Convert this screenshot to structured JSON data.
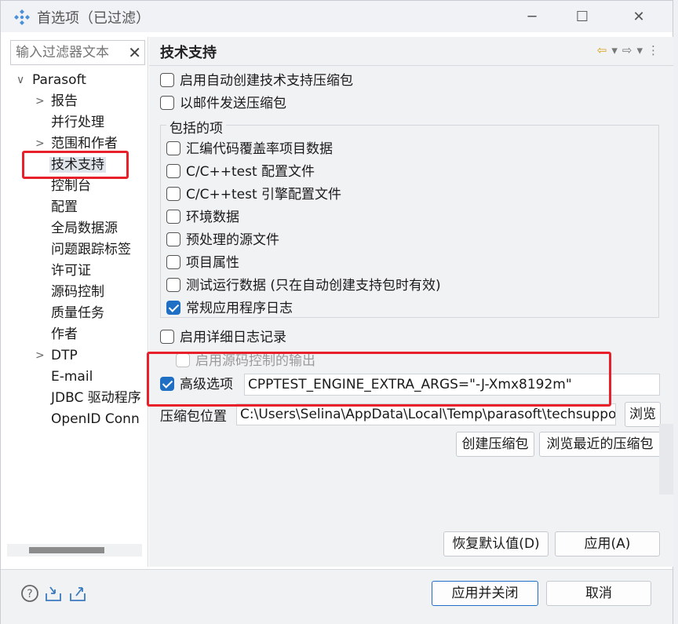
{
  "window": {
    "title": "首选项（已过滤）",
    "minimize": "─",
    "maximize": "☐",
    "close": "✕"
  },
  "filter": {
    "value": "输入过滤器文本",
    "clear": "✕"
  },
  "tree": [
    {
      "label": "Parasoft",
      "arrow": "∨"
    },
    {
      "label": "报告",
      "arrow": ">"
    },
    {
      "label": "并行处理",
      "arrow": ""
    },
    {
      "label": "范围和作者",
      "arrow": ">"
    },
    {
      "label": "技术支持",
      "arrow": "",
      "selected": true
    },
    {
      "label": "控制台",
      "arrow": ""
    },
    {
      "label": "配置",
      "arrow": ""
    },
    {
      "label": "全局数据源",
      "arrow": ""
    },
    {
      "label": "问题跟踪标签",
      "arrow": ""
    },
    {
      "label": "许可证",
      "arrow": ""
    },
    {
      "label": "源码控制",
      "arrow": ""
    },
    {
      "label": "质量任务",
      "arrow": ""
    },
    {
      "label": "作者",
      "arrow": ""
    },
    {
      "label": "DTP",
      "arrow": ">"
    },
    {
      "label": "E-mail",
      "arrow": ""
    },
    {
      "label": "JDBC 驱动程序",
      "arrow": ""
    },
    {
      "label": "OpenID Conn",
      "arrow": ""
    }
  ],
  "page": {
    "title": "技术支持",
    "nav": {
      "back": "⇦",
      "back_menu": "▾",
      "forward": "⇨",
      "forward_menu": "▾",
      "more": "⋮"
    },
    "auto_create": {
      "label": "启用自动创建技术支持压缩包",
      "checked": false
    },
    "email_send": {
      "label": "以邮件发送压缩包",
      "checked": false
    },
    "group_title": "包括的项",
    "items": [
      {
        "label": "汇编代码覆盖率项目数据",
        "checked": false
      },
      {
        "label": "C/C++test 配置文件",
        "checked": false
      },
      {
        "label": "C/C++test 引擎配置文件",
        "checked": false
      },
      {
        "label": "环境数据",
        "checked": false
      },
      {
        "label": "预处理的源文件",
        "checked": false
      },
      {
        "label": "项目属性",
        "checked": false
      },
      {
        "label": "测试运行数据 (只在自动创建支持包时有效)",
        "checked": false
      },
      {
        "label": "常规应用程序日志",
        "checked": true
      }
    ],
    "verbose_log": {
      "label": "启用详细日志记录",
      "checked": false
    },
    "scm_output": {
      "label": "启用源码控制的输出",
      "checked": false,
      "disabled": true
    },
    "advanced": {
      "label": "高级选项",
      "checked": true,
      "value": "CPPTEST_ENGINE_EXTRA_ARGS=\"-J-Xmx8192m\""
    },
    "archive_location": {
      "label": "压缩包位置",
      "value": "C:\\Users\\Selina\\AppData\\Local\\Temp\\parasoft\\techsupport",
      "browse": "浏览"
    },
    "create_archive": "创建压缩包",
    "browse_recent": "浏览最近的压缩包",
    "restore_defaults": "恢复默认值(D)",
    "apply": "应用(A)"
  },
  "footer": {
    "help_icon": "?",
    "apply_close": "应用并关闭",
    "cancel": "取消"
  },
  "colors": {
    "accent": "#1f6fc5",
    "highlight": "#e8202a"
  }
}
